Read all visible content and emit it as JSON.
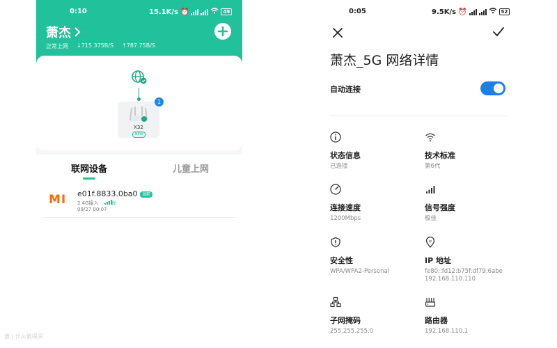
{
  "left": {
    "status": {
      "time": "0:10",
      "speed": "15.1K/s",
      "battery": "49"
    },
    "router_name": "萧杰",
    "online_status": "正常上网",
    "download_speed": "↓715.375B/S",
    "upload_speed": "↑787.75B/S",
    "router_model": "X32",
    "router_tag": "NEW",
    "router_badge": "1",
    "tabs": [
      "联网设备",
      "儿童上网"
    ],
    "device": {
      "logo": "MI",
      "name": "e01f.8833.0ba0",
      "badge": "当前",
      "band": "2.4G接入",
      "signal_quality": "优",
      "time": "09/27 00:07"
    }
  },
  "right": {
    "status": {
      "time": "0:05",
      "speed": "9.5K/s",
      "battery": "52"
    },
    "title": "萧杰_5G 网络详情",
    "auto_connect": {
      "label": "自动连接",
      "on": true
    },
    "items": [
      {
        "icon": "info-icon",
        "label": "状态信息",
        "value": "已连接"
      },
      {
        "icon": "wifi-icon",
        "label": "技术标准",
        "value": "第6代"
      },
      {
        "icon": "speedometer-icon",
        "label": "连接速度",
        "value": "1200Mbps"
      },
      {
        "icon": "signal-bars-icon",
        "label": "信号强度",
        "value": "极佳"
      },
      {
        "icon": "shield-icon",
        "label": "安全性",
        "value": "WPA/WPA2-Personal"
      },
      {
        "icon": "ip-icon",
        "label": "IP 地址",
        "value": "fe80::fd12:b75f:df79:6abe",
        "value2": "192.168.110.110"
      },
      {
        "icon": "subnet-icon",
        "label": "子网掩码",
        "value": "255.255.255.0"
      },
      {
        "icon": "router-icon",
        "label": "路由器",
        "value": "192.168.110.1"
      }
    ]
  },
  "watermark": "值 | 什么值得买"
}
